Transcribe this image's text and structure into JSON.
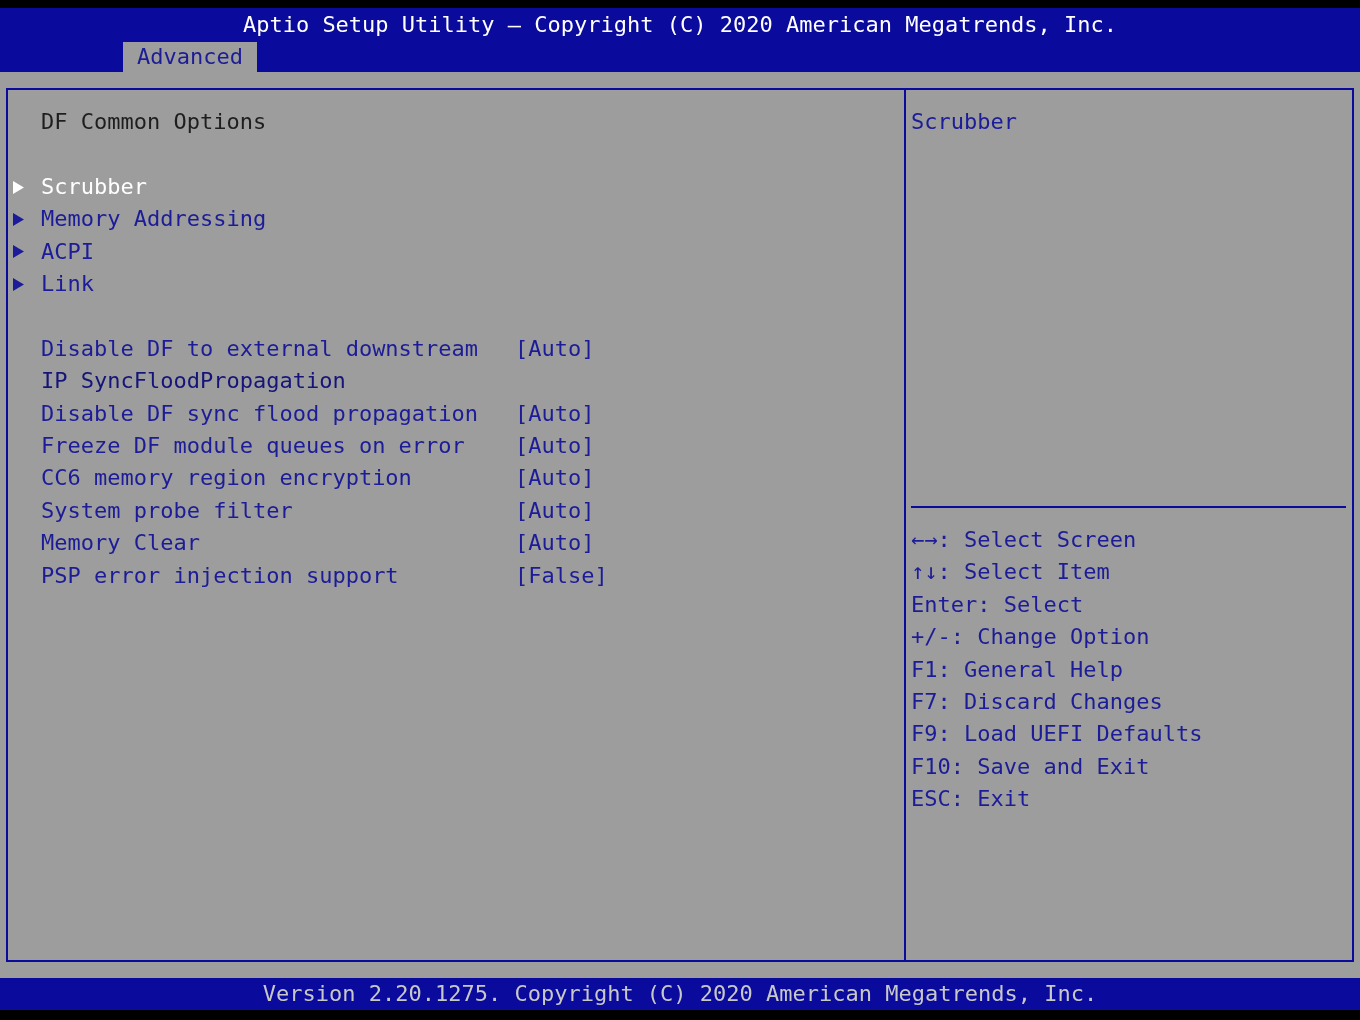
{
  "header": {
    "title": "Aptio Setup Utility – Copyright (C) 2020 American Megatrends, Inc."
  },
  "tabs": [
    {
      "label": "Advanced",
      "selected": true
    }
  ],
  "main": {
    "title": "DF Common Options",
    "submenus": [
      {
        "label": "Scrubber",
        "selected": true
      },
      {
        "label": "Memory Addressing",
        "selected": false
      },
      {
        "label": "ACPI",
        "selected": false
      },
      {
        "label": "Link",
        "selected": false
      }
    ],
    "settings": [
      {
        "kind": "option",
        "label": "Disable DF to external downstream",
        "value": "[Auto]"
      },
      {
        "kind": "text",
        "label": "IP SyncFloodPropagation"
      },
      {
        "kind": "option",
        "label": "Disable DF sync flood propagation",
        "value": "[Auto]"
      },
      {
        "kind": "option",
        "label": "Freeze DF module queues on error",
        "value": "[Auto]"
      },
      {
        "kind": "option",
        "label": "CC6 memory region encryption",
        "value": "[Auto]"
      },
      {
        "kind": "option",
        "label": "System probe filter",
        "value": "[Auto]"
      },
      {
        "kind": "option",
        "label": "Memory Clear",
        "value": "[Auto]"
      },
      {
        "kind": "option",
        "label": "PSP error injection support",
        "value": "[False]"
      }
    ]
  },
  "help": {
    "description": "Scrubber",
    "keys": [
      "←→: Select Screen",
      "↑↓: Select Item",
      "Enter: Select",
      "+/-: Change Option",
      "F1: General Help",
      "F7: Discard Changes",
      "F9: Load UEFI Defaults",
      "F10: Save and Exit",
      "ESC: Exit"
    ]
  },
  "footer": {
    "text": "Version 2.20.1275. Copyright (C) 2020 American Megatrends, Inc."
  }
}
